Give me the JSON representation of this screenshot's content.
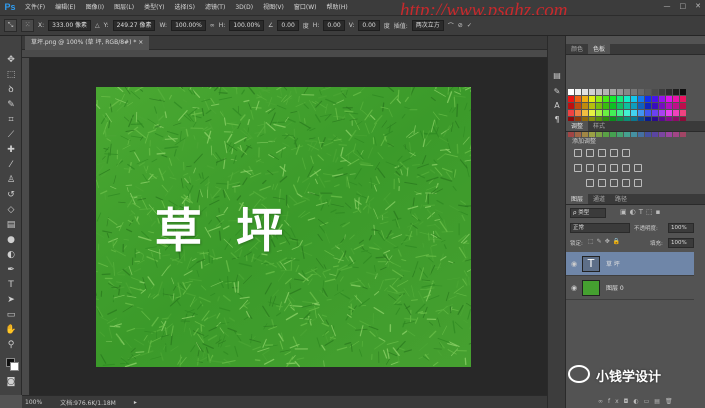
{
  "app": {
    "logo": "Ps"
  },
  "menubar": {
    "items": [
      "文件(F)",
      "编辑(E)",
      "图像(I)",
      "图层(L)",
      "类型(Y)",
      "选择(S)",
      "滤镜(T)",
      "3D(D)",
      "视图(V)",
      "窗口(W)",
      "帮助(H)"
    ],
    "window_controls": [
      "—",
      "□",
      "✕"
    ]
  },
  "options_bar": {
    "x_label": "X:",
    "x_value": "333.00 像素",
    "y_label": "Y:",
    "y_value": "249.27 像素",
    "w_label": "W:",
    "w_value": "100.00%",
    "h_label": "H:",
    "h_value": "100.00%",
    "angle_value": "0.00",
    "h2_label": "H:",
    "h2_value": "0.00",
    "v_label": "V:",
    "v_value": "0.00",
    "interp_label": "插值:",
    "interp_value": "两次立方"
  },
  "document": {
    "tab_label": "草坪.png @ 100% (草 坪, RGB/8#) *  ×",
    "canvas_text": "草 坪",
    "zoom": "100%",
    "doc_size": "文档:976.6K/1.18M"
  },
  "panels": {
    "color_tabs": [
      "颜色",
      "色板"
    ],
    "adjust_tabs": [
      "调整",
      "样式"
    ],
    "adjust_hint": "添加调整",
    "layer_tabs": [
      "图层",
      "通道",
      "路径"
    ],
    "filter_kind": "ρ 类型",
    "blend_mode": "正常",
    "opacity_label": "不透明度:",
    "opacity_value": "100%",
    "lock_label": "锁定:",
    "fill_label": "填充:",
    "fill_value": "100%",
    "layers": [
      {
        "name": "草 坪",
        "thumb": "T",
        "selected": true
      },
      {
        "name": "图层 0",
        "thumb": "",
        "selected": false
      }
    ]
  },
  "watermarks": {
    "url": "http://www.psahz.com",
    "credit": "小钱学设计"
  },
  "colors": {
    "ps_blue": "#2f9cf0",
    "grass": "#3f9b2d",
    "selected_layer": "#6f86a8"
  }
}
